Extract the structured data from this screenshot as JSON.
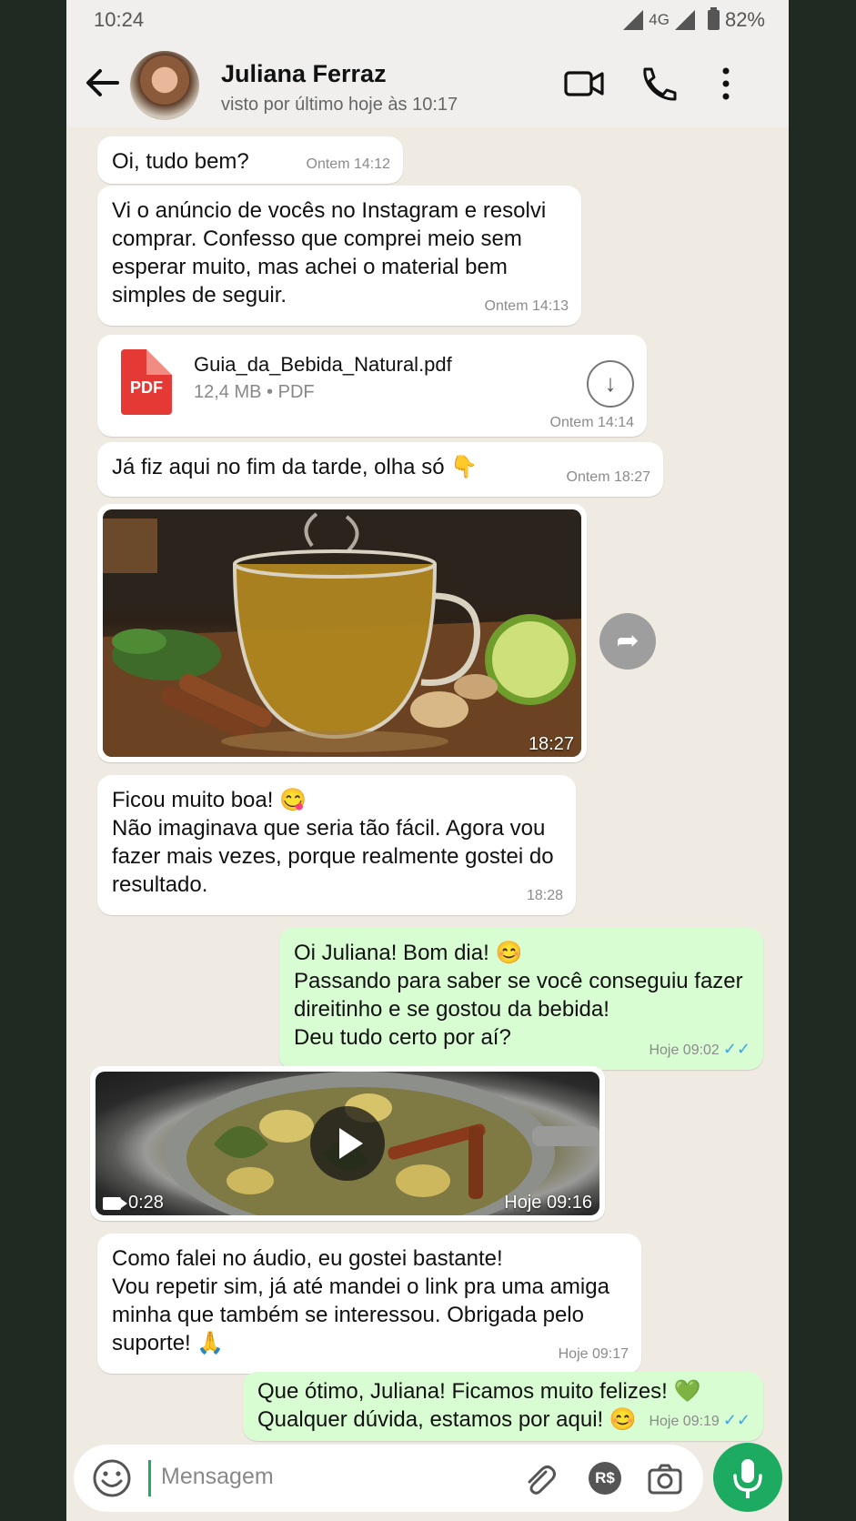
{
  "status_bar": {
    "time": "10:24",
    "network": "4G",
    "battery": "82%"
  },
  "contact": {
    "name": "Juliana Ferraz",
    "last_seen": "visto por último hoje às 10:17"
  },
  "messages": [
    {
      "type": "text",
      "direction": "in",
      "text": "Oi, tudo bem?",
      "time": "Ontem 14:12"
    },
    {
      "type": "text",
      "direction": "in",
      "text": "Vi o anúncio de vocês no Instagram e resolvi comprar. Confesso que comprei meio sem esperar muito, mas achei o material bem simples de seguir.",
      "time": "Ontem 14:13"
    },
    {
      "type": "document",
      "direction": "in",
      "icon_label": "PDF",
      "file_name": "Guia_da_Bebida_Natural.pdf",
      "file_meta": "12,4 MB • PDF",
      "time": "Ontem 14:14"
    },
    {
      "type": "text",
      "direction": "in",
      "text": "Já fiz aqui no fim da tarde, olha só 👇",
      "time": "Ontem 18:27"
    },
    {
      "type": "image",
      "direction": "in",
      "time": "18:27"
    },
    {
      "type": "text",
      "direction": "in",
      "text": "Ficou muito boa! 😋\nNão imaginava que seria tão fácil. Agora vou fazer mais vezes, porque realmente gostei do resultado.",
      "time": "18:28"
    },
    {
      "type": "text",
      "direction": "out",
      "text": "Oi Juliana! Bom dia! 😊\nPassando para saber se você conseguiu fazer direitinho e se gostou da bebida!\nDeu tudo certo por aí?",
      "time": "Hoje 09:02",
      "ticks": "✓✓"
    },
    {
      "type": "video",
      "direction": "in",
      "duration": "0:28",
      "time": "Hoje 09:16"
    },
    {
      "type": "text",
      "direction": "in",
      "text": "Como falei no áudio, eu gostei bastante!\nVou repetir sim, já até mandei o link pra uma amiga minha que também se interessou. Obrigada pelo suporte! 🙏",
      "time": "Hoje 09:17"
    },
    {
      "type": "text",
      "direction": "out",
      "text": "Que ótimo, Juliana! Ficamos muito felizes! 💚\nQualquer dúvida, estamos por aqui! 😊",
      "time": "Hoje 09:19",
      "ticks": "✓✓"
    }
  ],
  "composer": {
    "placeholder": "Mensagem",
    "currency_label": "R$"
  },
  "colors": {
    "outgoing_bubble": "#d9fdd3",
    "accent_green": "#1daa61",
    "read_ticks": "#3ea6e0",
    "pdf_red": "#e53935"
  }
}
